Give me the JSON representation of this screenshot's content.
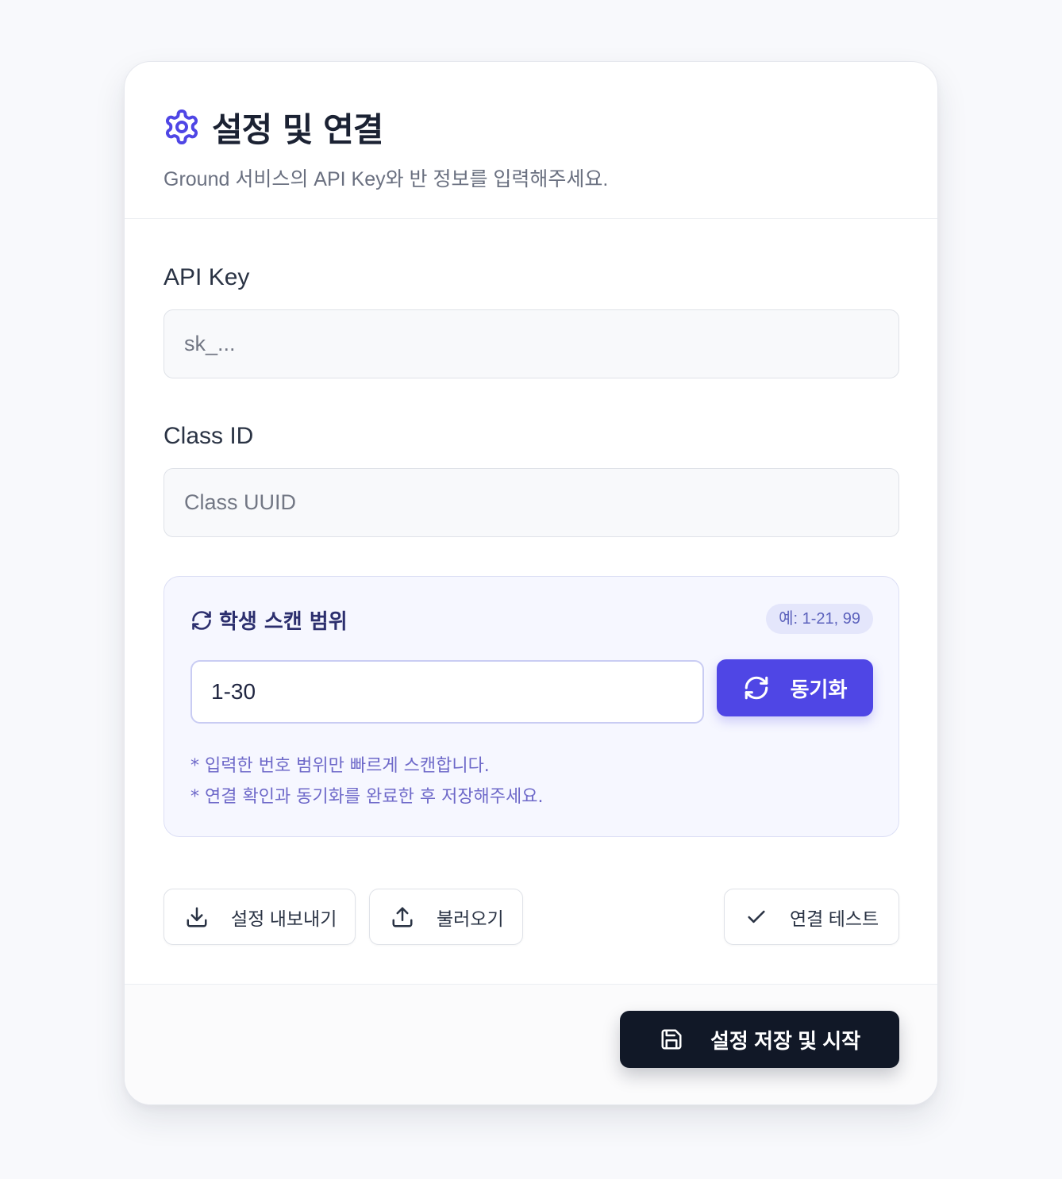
{
  "header": {
    "title": "설정 및 연결",
    "subtitle": "Ground 서비스의 API Key와 반 정보를 입력해주세요."
  },
  "api_key": {
    "label": "API Key",
    "placeholder": "sk_...",
    "value": ""
  },
  "class_id": {
    "label": "Class ID",
    "placeholder": "Class UUID",
    "value": ""
  },
  "scan": {
    "title": "학생 스캔 범위",
    "example_badge": "예: 1-21, 99",
    "range_value": "1-30",
    "sync_label": "동기화",
    "notes": [
      "* 입력한 번호 범위만 빠르게 스캔합니다.",
      "* 연결 확인과 동기화를 완료한 후 저장해주세요."
    ]
  },
  "actions": {
    "export_label": "설정 내보내기",
    "import_label": "불러오기",
    "test_label": "연결 테스트"
  },
  "footer": {
    "save_label": "설정 저장 및 시작"
  },
  "colors": {
    "accent": "#4f46e5",
    "dark_button": "#111827",
    "scan_box_bg": "#f6f7ff"
  },
  "icons": {
    "title": "gear-icon",
    "scan": "refresh-icon",
    "sync": "refresh-icon",
    "export": "download-icon",
    "import": "upload-icon",
    "test": "check-icon",
    "save": "save-icon"
  }
}
